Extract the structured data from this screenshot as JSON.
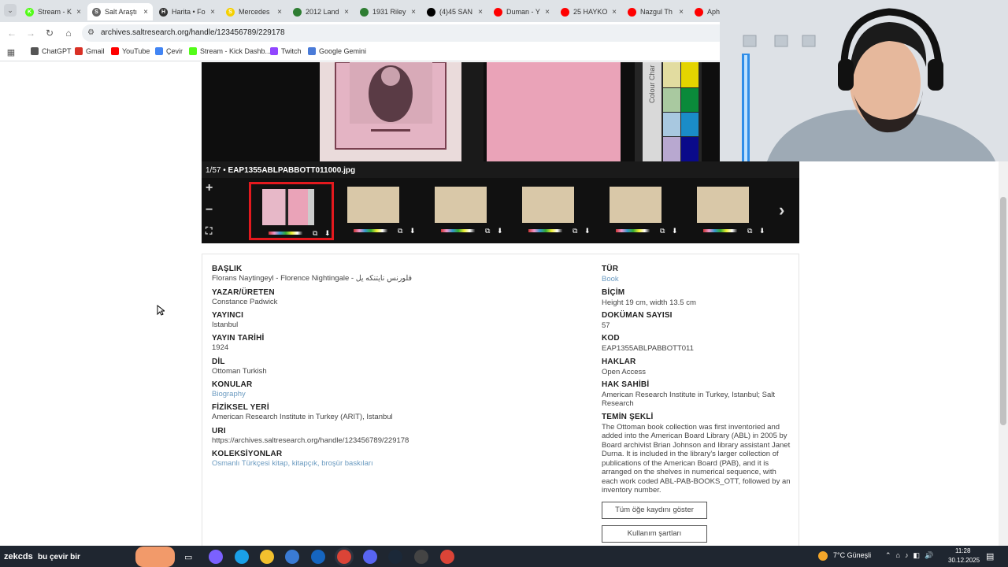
{
  "browser": {
    "tabs": [
      {
        "title": "Stream - K",
        "color": "#53fc18",
        "letter": "K"
      },
      {
        "title": "Salt Araştı",
        "color": "#666",
        "letter": "S"
      },
      {
        "title": "Harita • Fo",
        "color": "#333",
        "letter": "H"
      },
      {
        "title": "Mercedes",
        "color": "#f5d000",
        "letter": "S"
      },
      {
        "title": "2012 Land",
        "color": "#2e7d32",
        "letter": ""
      },
      {
        "title": "1931 Riley",
        "color": "#2e7d32",
        "letter": ""
      },
      {
        "title": "(4)45 SAN",
        "color": "#000",
        "letter": ""
      },
      {
        "title": "Duman - Y",
        "color": "#ff0000",
        "letter": ""
      },
      {
        "title": "25 HAYKO",
        "color": "#ff0000",
        "letter": ""
      },
      {
        "title": "Nazgul Th",
        "color": "#ff0000",
        "letter": ""
      },
      {
        "title": "Aph",
        "color": "#ff0000",
        "letter": ""
      }
    ],
    "url": "archives.saltresearch.org/handle/123456789/229178",
    "bookmarks": [
      {
        "label": "ChatGPT",
        "color": "#555"
      },
      {
        "label": "Gmail",
        "color": "#d93025"
      },
      {
        "label": "YouTube",
        "color": "#ff0000"
      },
      {
        "label": "Çevir",
        "color": "#4285f4"
      },
      {
        "label": "Stream - Kick Dashb...",
        "color": "#53fc18"
      },
      {
        "label": "Twitch",
        "color": "#9146ff"
      },
      {
        "label": "Google Gemini",
        "color": "#4a7bd8"
      }
    ]
  },
  "viewer": {
    "counter": "1/57",
    "filename": "EAP1355ABLPABBOTT011000.jpg",
    "colour_chart_label": "Colour Char"
  },
  "metadata": {
    "left": [
      {
        "label": "BAŞLIK",
        "value": "Florans Naytingeyl - Florence Nightingale - فلورنس نايتنكه يل",
        "link": false
      },
      {
        "label": "YAZAR/ÜRETEN",
        "value": "Constance Padwick",
        "link": false
      },
      {
        "label": "YAYINCI",
        "value": "Istanbul",
        "link": false
      },
      {
        "label": "YAYIN TARİHİ",
        "value": "1924",
        "link": false
      },
      {
        "label": "DİL",
        "value": "Ottoman Turkish",
        "link": false
      },
      {
        "label": "KONULAR",
        "value": "Biography",
        "link": true
      },
      {
        "label": "FİZİKSEL YERİ",
        "value": "American Research Institute in Turkey (ARIT), Istanbul",
        "link": false
      },
      {
        "label": "URI",
        "value": "https://archives.saltresearch.org/handle/123456789/229178",
        "link": false
      },
      {
        "label": "KOLEKSİYONLAR",
        "value": "Osmanlı Türkçesi kitap, kitapçık, broşür baskıları",
        "link": true
      }
    ],
    "right": [
      {
        "label": "TÜR",
        "value": "Book",
        "link": true
      },
      {
        "label": "BİÇİM",
        "value": "Height 19 cm, width 13.5 cm",
        "link": false
      },
      {
        "label": "DOKÜMAN SAYISI",
        "value": "57",
        "link": false
      },
      {
        "label": "KOD",
        "value": "EAP1355ABLPABBOTT011",
        "link": false
      },
      {
        "label": "HAKLAR",
        "value": "Open Access",
        "link": false
      },
      {
        "label": "HAK SAHİBİ",
        "value": "American Research Institute in Turkey, Istanbul; Salt Research",
        "link": false
      },
      {
        "label": "TEMİN ŞEKLİ",
        "value": "The Ottoman book collection was first inventoried and added into the American Board Library (ABL) in 2005 by Board archivist Brian Johnson and library assistant Janet Durna. It is included in the library's larger collection of publications of the American Board (PAB), and it is arranged on the shelves in numerical sequence, with each work coded ABL-PAB-BOOKS_OTT, followed by an inventory number.",
        "link": false
      }
    ],
    "buttons": {
      "show_all": "Tüm öğe kaydını göster",
      "terms": "Kullanım şartları"
    }
  },
  "taskbar": {
    "search_text": "bu çevir bir",
    "overlay_text": "zekcds",
    "weather": "7°C Güneşli",
    "time": "11:28",
    "date": "30.12.2025"
  }
}
